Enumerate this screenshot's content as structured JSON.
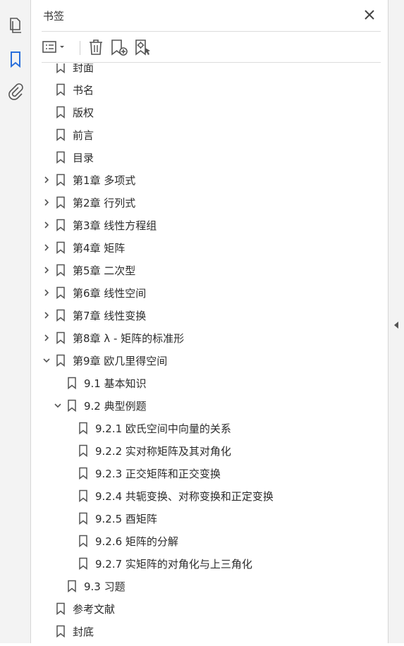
{
  "panel": {
    "title": "书签"
  },
  "rail": {
    "icons": [
      "pages-icon",
      "bookmark-icon",
      "attachment-icon"
    ]
  },
  "toolbar": {
    "buttons": [
      "options-menu-icon",
      "delete-icon",
      "new-bookmark-icon",
      "new-bookmark-from-structure-icon"
    ]
  },
  "bookmarks": [
    {
      "label": "封面",
      "level": 0,
      "toggle": "none"
    },
    {
      "label": "书名",
      "level": 0,
      "toggle": "none"
    },
    {
      "label": "版权",
      "level": 0,
      "toggle": "none"
    },
    {
      "label": "前言",
      "level": 0,
      "toggle": "none"
    },
    {
      "label": "目录",
      "level": 0,
      "toggle": "none"
    },
    {
      "label": "第1章 多项式",
      "level": 0,
      "toggle": "collapsed"
    },
    {
      "label": "第2章 行列式",
      "level": 0,
      "toggle": "collapsed"
    },
    {
      "label": "第3章 线性方程组",
      "level": 0,
      "toggle": "collapsed"
    },
    {
      "label": "第4章 矩阵",
      "level": 0,
      "toggle": "collapsed"
    },
    {
      "label": "第5章 二次型",
      "level": 0,
      "toggle": "collapsed"
    },
    {
      "label": "第6章 线性空间",
      "level": 0,
      "toggle": "collapsed"
    },
    {
      "label": "第7章 线性变换",
      "level": 0,
      "toggle": "collapsed"
    },
    {
      "label": "第8章 λ - 矩阵的标准形",
      "level": 0,
      "toggle": "collapsed"
    },
    {
      "label": "第9章 欧几里得空间",
      "level": 0,
      "toggle": "expanded"
    },
    {
      "label": "9.1 基本知识",
      "level": 1,
      "toggle": "none"
    },
    {
      "label": "9.2 典型例题",
      "level": 1,
      "toggle": "expanded"
    },
    {
      "label": "9.2.1 欧氏空间中向量的关系",
      "level": 2,
      "toggle": "none"
    },
    {
      "label": "9.2.2 实对称矩阵及其对角化",
      "level": 2,
      "toggle": "none"
    },
    {
      "label": "9.2.3 正交矩阵和正交变换",
      "level": 2,
      "toggle": "none"
    },
    {
      "label": "9.2.4 共轭变换、对称变换和正定变换",
      "level": 2,
      "toggle": "none"
    },
    {
      "label": "9.2.5 酉矩阵",
      "level": 2,
      "toggle": "none"
    },
    {
      "label": "9.2.6 矩阵的分解",
      "level": 2,
      "toggle": "none"
    },
    {
      "label": "9.2.7 实矩阵的对角化与上三角化",
      "level": 2,
      "toggle": "none"
    },
    {
      "label": "9.3 习题",
      "level": 1,
      "toggle": "none"
    },
    {
      "label": "参考文献",
      "level": 0,
      "toggle": "none"
    },
    {
      "label": "封底",
      "level": 0,
      "toggle": "none"
    }
  ],
  "colors": {
    "accent": "#2a6fdb",
    "icon": "#555555"
  }
}
